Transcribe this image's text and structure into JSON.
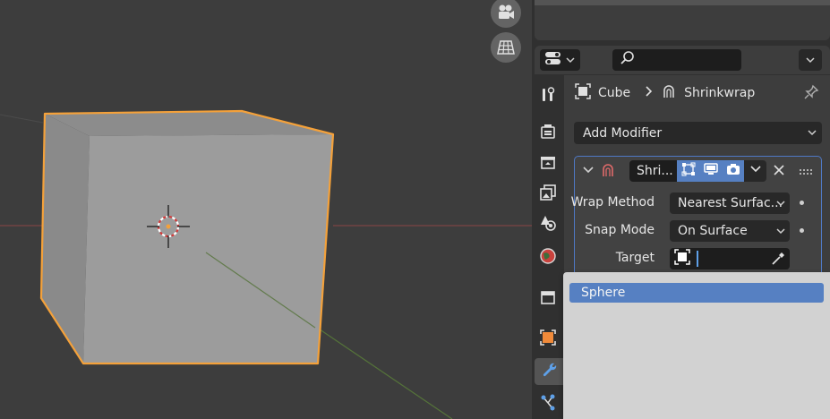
{
  "viewport": {
    "object_name": "Cube",
    "nav_icons": [
      "camera-view-icon",
      "grid-ortho-icon"
    ],
    "colors": {
      "background": "#3d3d3d",
      "selection_outline": "#f4a13a",
      "cube_front": "#a0a0a0",
      "cube_side": "#8e8e8e",
      "x_axis": "#9a4a4a",
      "y_axis": "#5a7a3a"
    }
  },
  "properties": {
    "header": {
      "search_placeholder": "",
      "editor_icon": "properties-editor-icon",
      "options_icon": "chevron-down-icon"
    },
    "breadcrumb": {
      "object": "Cube",
      "modifier": "Shrinkwrap"
    },
    "add_modifier_label": "Add Modifier",
    "modifier": {
      "name": "Shri...",
      "fields": [
        {
          "label": "Wrap Method",
          "value": "Nearest Surfac..."
        },
        {
          "label": "Snap Mode",
          "value": "On Surface"
        },
        {
          "label": "Target",
          "value": ""
        }
      ]
    },
    "tabs": [
      "tool-tab",
      "render-tab",
      "output-tab",
      "view-layer-tab",
      "scene-tab",
      "world-tab",
      "object-tab",
      "modifier-tab",
      "particles-tab"
    ],
    "active_tab": "modifier-tab",
    "accent": "#5680c2"
  },
  "search_popup": {
    "items": [
      "Sphere"
    ],
    "highlighted": "Sphere"
  }
}
